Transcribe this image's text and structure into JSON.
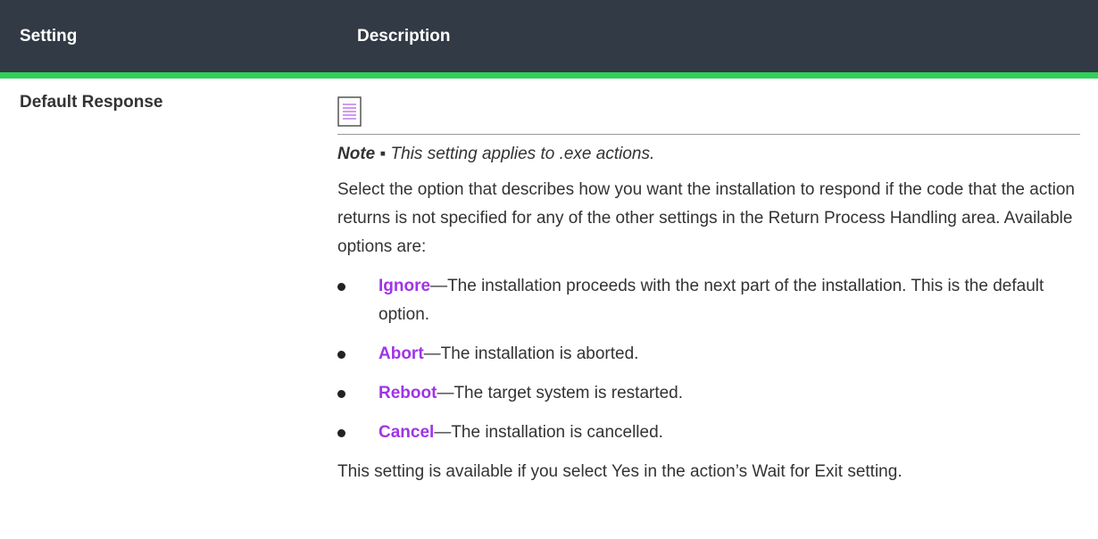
{
  "header": {
    "setting": "Setting",
    "description": "Description"
  },
  "row": {
    "setting": "Default Response",
    "note_label": "Note",
    "note_sep": " ▪ ",
    "note_text": "This setting applies to .exe actions.",
    "intro": "Select the option that describes how you want the installation to respond if the code that the action returns is not specified for any of the other settings in the Return Process Handling area. Available options are:",
    "options": [
      {
        "name": "Ignore",
        "text": "—The installation proceeds with the next part of the installation. This is the default option."
      },
      {
        "name": "Abort",
        "text": "—The installation is aborted."
      },
      {
        "name": "Reboot",
        "text": "—The target system is restarted."
      },
      {
        "name": "Cancel",
        "text": "—The installation is cancelled."
      }
    ],
    "footer": "This setting is available if you select Yes in the action’s Wait for Exit setting."
  },
  "icons": {
    "note": "note-icon"
  },
  "colors": {
    "header_bg": "#323a45",
    "header_accent": "#2fd158",
    "option_link": "#a034e6"
  }
}
